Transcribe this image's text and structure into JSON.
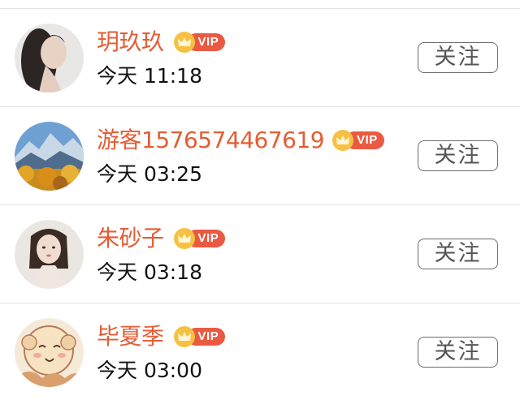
{
  "users": [
    {
      "name": "玥玖玖",
      "time": "今天 11:18",
      "vip_label": "VIP",
      "follow_label": "关注"
    },
    {
      "name": "游客1576574467619",
      "time": "今天 03:25",
      "vip_label": "VIP",
      "follow_label": "关注"
    },
    {
      "name": "朱砂子",
      "time": "今天 03:18",
      "vip_label": "VIP",
      "follow_label": "关注"
    },
    {
      "name": "毕夏季",
      "time": "今天 03:00",
      "vip_label": "VIP",
      "follow_label": "关注"
    }
  ],
  "colors": {
    "name": "#e45d34",
    "vip_pill": "#ea5a42",
    "vip_crown": "#f6c143",
    "follow_border": "#6b6b6b"
  },
  "icons": [
    "crown-icon"
  ]
}
